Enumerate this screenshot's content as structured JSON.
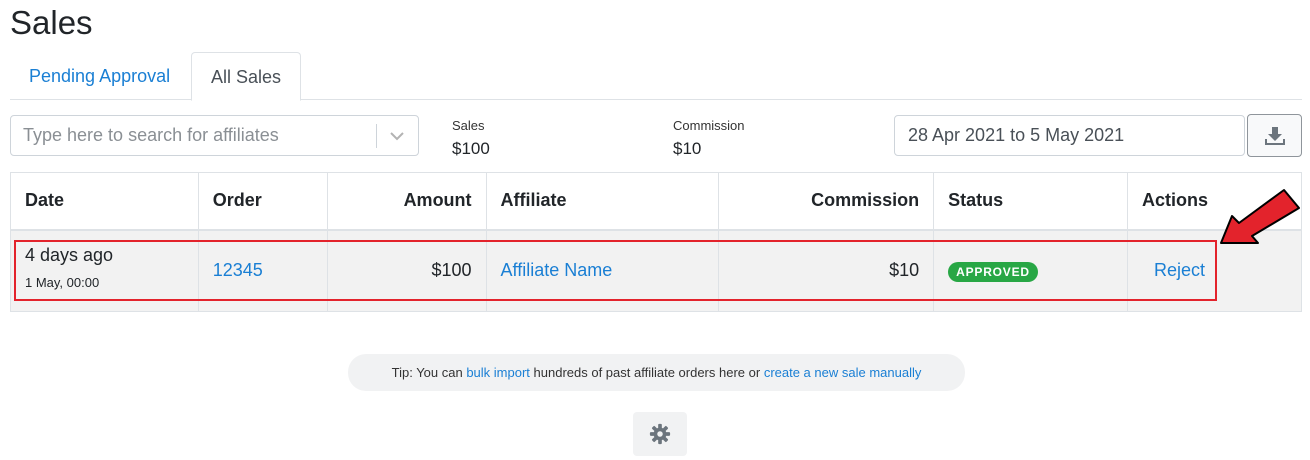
{
  "page": {
    "title": "Sales"
  },
  "tabs": [
    {
      "label": "Pending Approval",
      "active": false
    },
    {
      "label": "All Sales",
      "active": true
    }
  ],
  "filters": {
    "search_placeholder": "Type here to search for affiliates",
    "date_range": "28 Apr 2021 to 5 May 2021"
  },
  "stats": {
    "sales": {
      "label": "Sales",
      "value": "$100"
    },
    "commission": {
      "label": "Commission",
      "value": "$10"
    }
  },
  "table": {
    "headers": [
      "Date",
      "Order",
      "Amount",
      "Affiliate",
      "Commission",
      "Status",
      "Actions"
    ],
    "rows": [
      {
        "date_relative": "4 days ago",
        "date_exact": "1 May, 00:00",
        "order": "12345",
        "amount": "$100",
        "affiliate": "Affiliate Name",
        "commission": "$10",
        "status": "APPROVED",
        "action": "Reject"
      }
    ]
  },
  "tip": {
    "prefix": "Tip: You can ",
    "link1": "bulk import",
    "middle": " hundreds of past affiliate orders here or ",
    "link2": "create a new sale manually"
  },
  "icons": {
    "dropdown": "chevron-down-icon",
    "download": "download-icon",
    "settings": "gear-icon",
    "annotation": "arrow-icon"
  },
  "colors": {
    "link": "#1a7fd4",
    "approved_badge": "#28a745",
    "highlight": "#e3232c"
  }
}
